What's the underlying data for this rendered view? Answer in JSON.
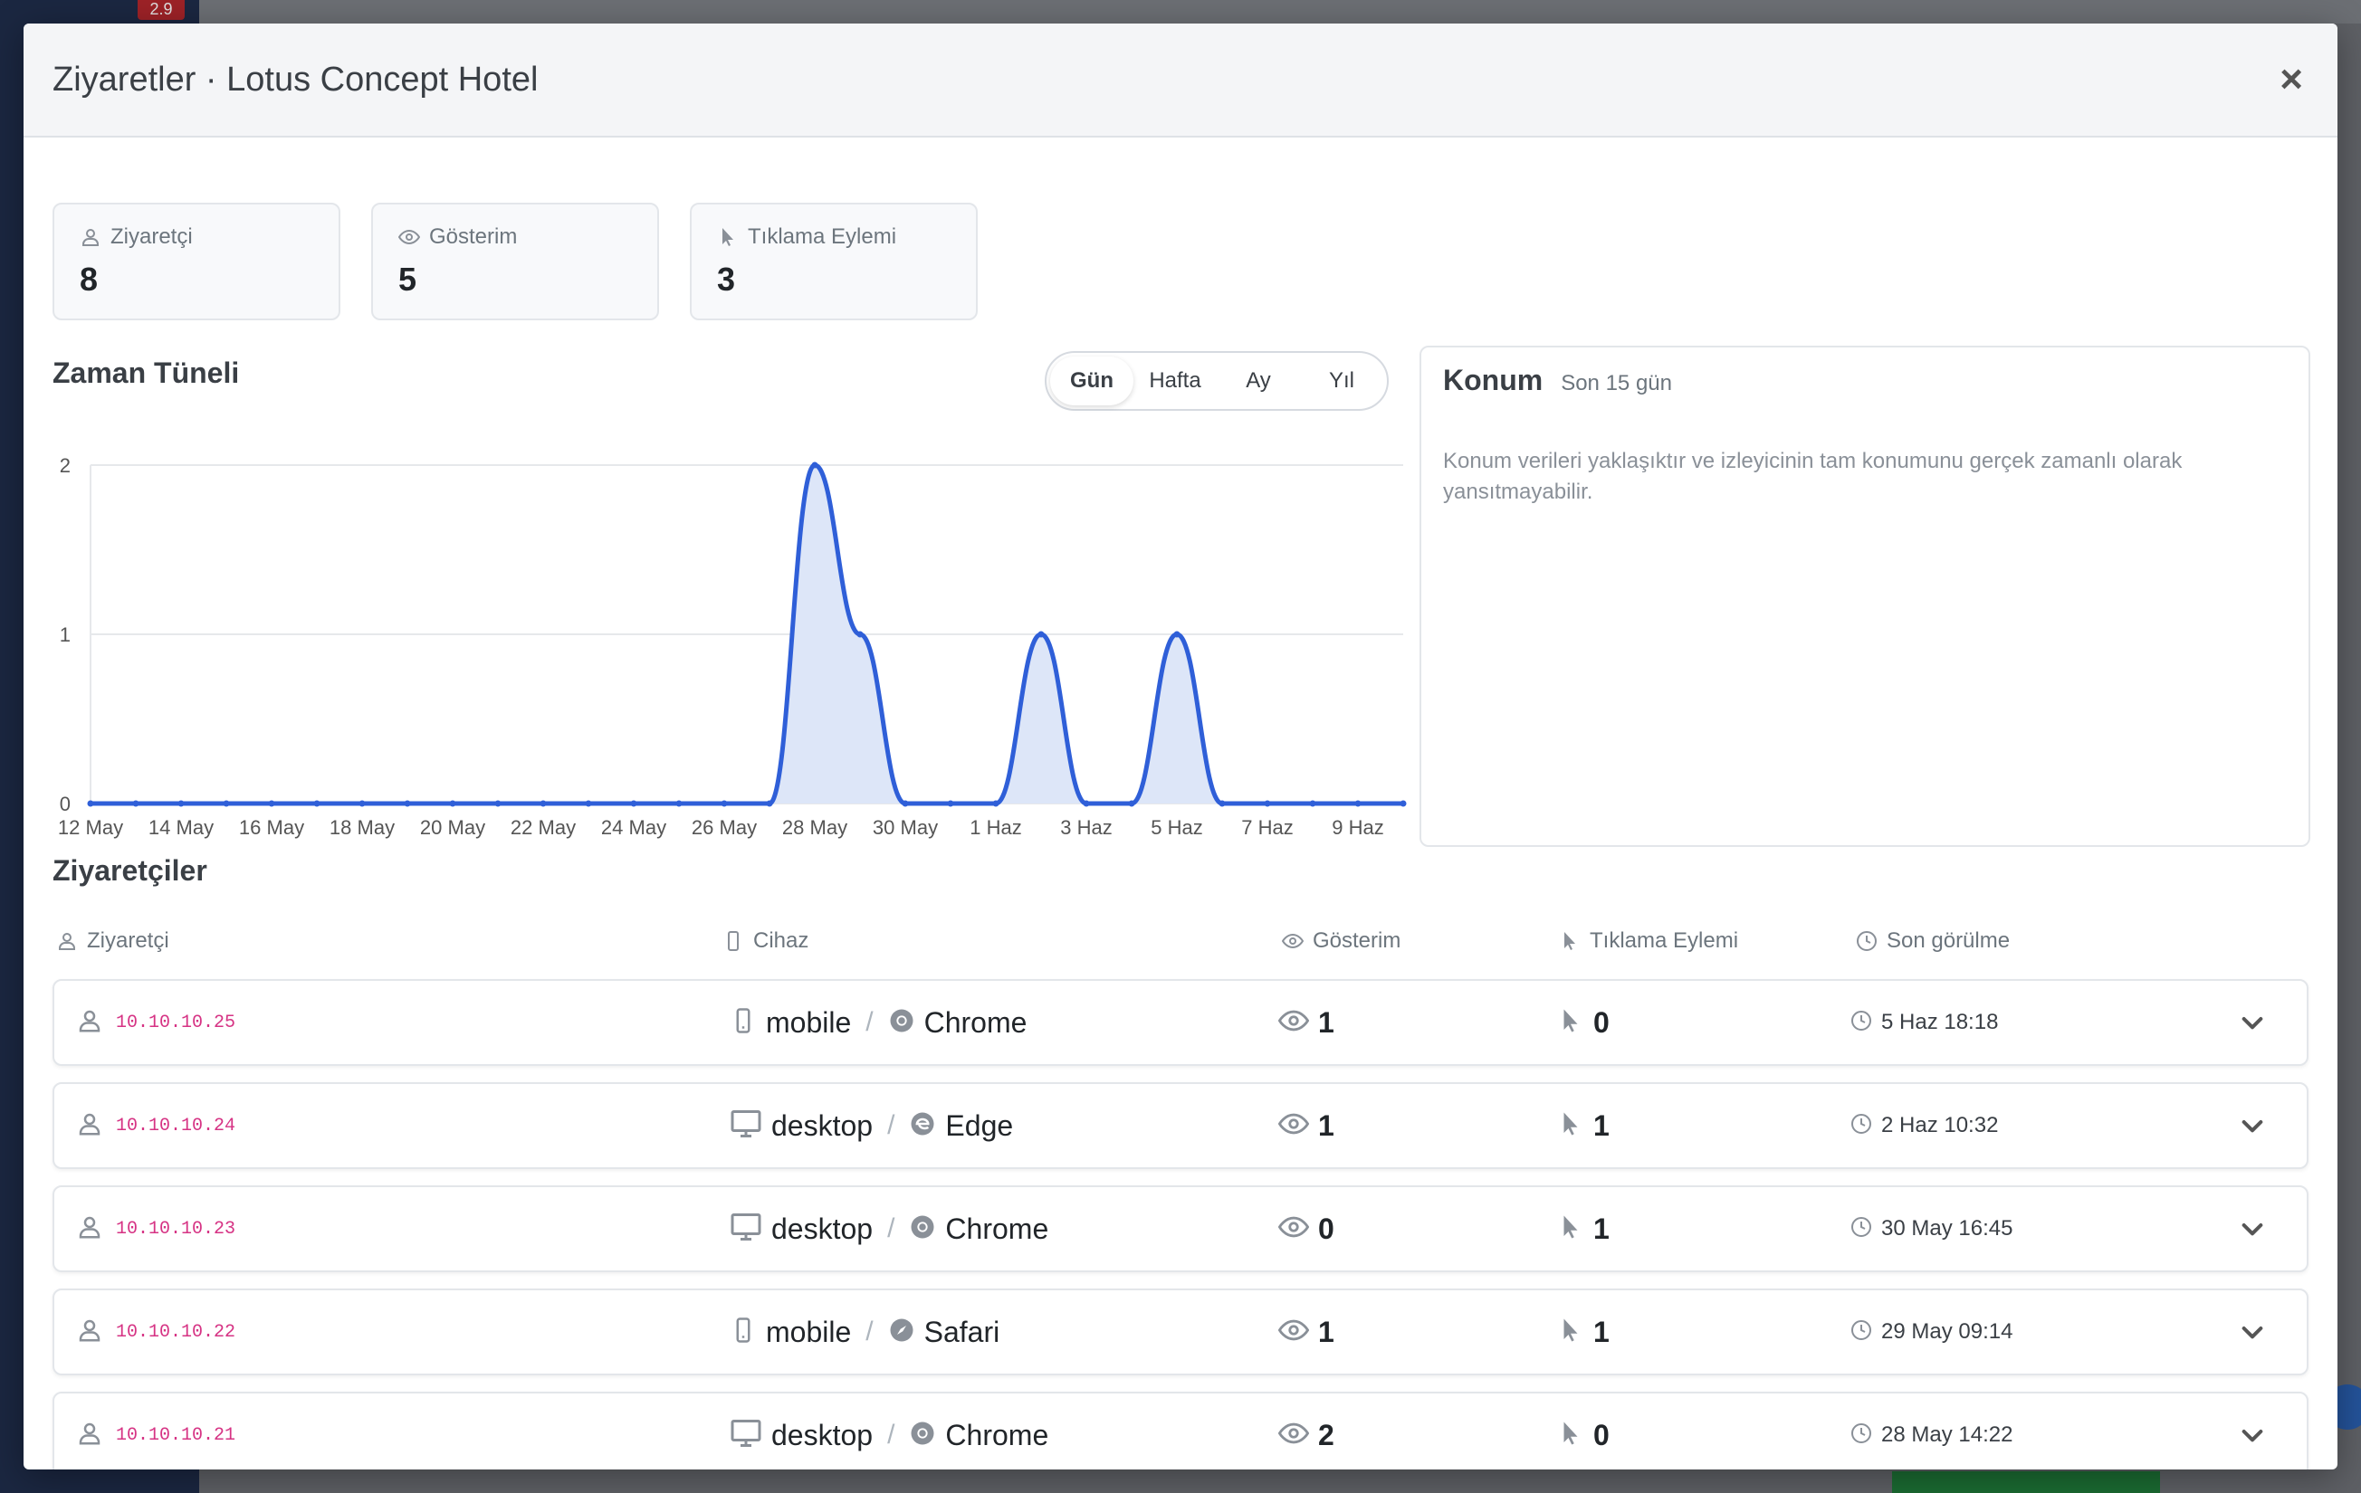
{
  "modal": {
    "title": "Ziyaretler · Lotus Concept Hotel",
    "close_label": "×"
  },
  "stats": [
    {
      "label": "Ziyaretçi",
      "value": "8",
      "icon": "user-icon"
    },
    {
      "label": "Gösterim",
      "value": "5",
      "icon": "eye-icon"
    },
    {
      "label": "Tıklama Eylemi",
      "value": "3",
      "icon": "pointer-icon"
    }
  ],
  "timeline": {
    "title": "Zaman Tüneli",
    "ranges": [
      "Gün",
      "Hafta",
      "Ay",
      "Yıl"
    ],
    "active_range": "Gün"
  },
  "chart_data": {
    "type": "area",
    "x": [
      "12 May",
      "13 May",
      "14 May",
      "15 May",
      "16 May",
      "17 May",
      "18 May",
      "19 May",
      "20 May",
      "21 May",
      "22 May",
      "23 May",
      "24 May",
      "25 May",
      "26 May",
      "27 May",
      "28 May",
      "29 May",
      "30 May",
      "31 May",
      "1 Haz",
      "2 Haz",
      "3 Haz",
      "4 Haz",
      "5 Haz",
      "6 Haz",
      "7 Haz",
      "8 Haz",
      "9 Haz",
      "10 Haz"
    ],
    "values": [
      0,
      0,
      0,
      0,
      0,
      0,
      0,
      0,
      0,
      0,
      0,
      0,
      0,
      0,
      0,
      0,
      2,
      1,
      0,
      0,
      0,
      1,
      0,
      0,
      1,
      0,
      0,
      0,
      0,
      0
    ],
    "xticks": [
      "12 May",
      "14 May",
      "16 May",
      "18 May",
      "20 May",
      "22 May",
      "24 May",
      "26 May",
      "28 May",
      "30 May",
      "1 Haz",
      "3 Haz",
      "5 Haz",
      "7 Haz",
      "9 Haz"
    ],
    "yticks": [
      "0",
      "1",
      "2"
    ],
    "ylim": [
      0,
      2
    ],
    "grid": true,
    "line_color": "#2f5fd8",
    "fill_color": "#dde6f8"
  },
  "location": {
    "title": "Konum",
    "subtitle": "Son 15 gün",
    "note": "Konum verileri yaklaşıktır ve izleyicinin tam konumunu gerçek zamanlı olarak yansıtmayabilir."
  },
  "visitors": {
    "title": "Ziyaretçiler",
    "headers": {
      "visitor": "Ziyaretçi",
      "device": "Cihaz",
      "views": "Gösterim",
      "clicks": "Tıklama Eylemi",
      "last_seen": "Son görülme"
    },
    "separator": "/",
    "rows": [
      {
        "ip": "10.10.10.25",
        "device": "mobile",
        "device_icon": "phone-icon",
        "browser": "Chrome",
        "browser_icon": "chrome-icon",
        "views": "1",
        "clicks": "0",
        "last_seen": "5 Haz 18:18"
      },
      {
        "ip": "10.10.10.24",
        "device": "desktop",
        "device_icon": "monitor-icon",
        "browser": "Edge",
        "browser_icon": "edge-icon",
        "views": "1",
        "clicks": "1",
        "last_seen": "2 Haz 10:32"
      },
      {
        "ip": "10.10.10.23",
        "device": "desktop",
        "device_icon": "monitor-icon",
        "browser": "Chrome",
        "browser_icon": "chrome-icon",
        "views": "0",
        "clicks": "1",
        "last_seen": "30 May 16:45"
      },
      {
        "ip": "10.10.10.22",
        "device": "mobile",
        "device_icon": "phone-icon",
        "browser": "Safari",
        "browser_icon": "safari-icon",
        "views": "1",
        "clicks": "1",
        "last_seen": "29 May 09:14"
      },
      {
        "ip": "10.10.10.21",
        "device": "desktop",
        "device_icon": "monitor-icon",
        "browser": "Chrome",
        "browser_icon": "chrome-icon",
        "views": "2",
        "clicks": "0",
        "last_seen": "28 May 14:22"
      }
    ]
  },
  "background": {
    "badge": "2.9"
  }
}
